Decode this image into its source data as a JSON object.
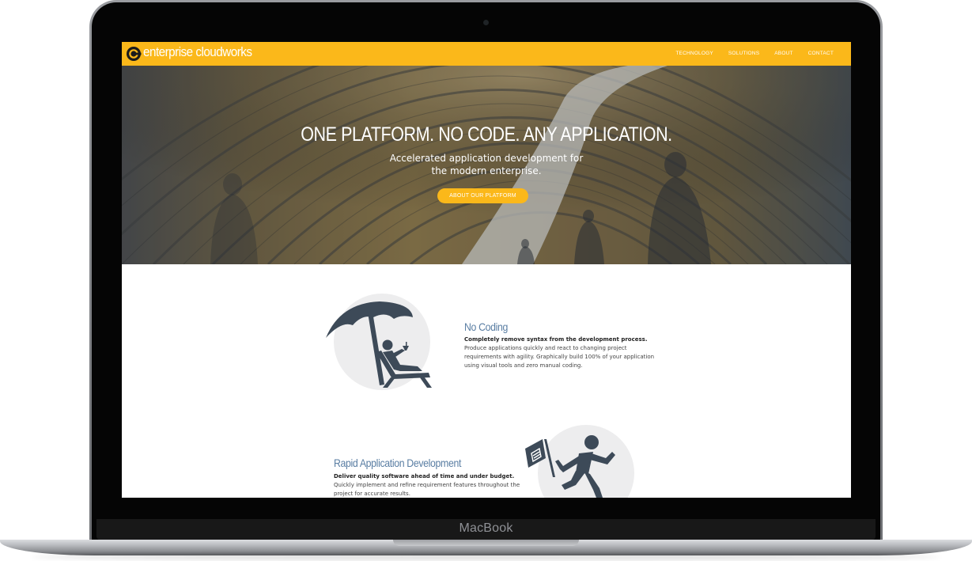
{
  "device": {
    "label": "MacBook"
  },
  "site": {
    "logo_text": "enterprise cloudworks",
    "brand_color": "#fbb81a",
    "nav": [
      {
        "label": "TECHNOLOGY"
      },
      {
        "label": "SOLUTIONS"
      },
      {
        "label": "ABOUT"
      },
      {
        "label": "CONTACT"
      }
    ]
  },
  "hero": {
    "title": "ONE PLATFORM. NO CODE. ANY APPLICATION.",
    "subtitle_line1": "Accelerated application development for",
    "subtitle_line2": "the modern enterprise.",
    "cta_label": "ABOUT OUR PLATFORM"
  },
  "features": [
    {
      "title": "No Coding",
      "lead": "Completely remove syntax from the development process.",
      "body": [
        "Produce applications quickly and react to changing project",
        "requirements with agility. Graphically build 100% of your application",
        "using visual tools and zero manual coding."
      ],
      "icon": "beach-chair-umbrella-icon"
    },
    {
      "title": "Rapid Application Development",
      "lead": "Deliver quality software ahead of time and under budget.",
      "body": [
        "Quickly implement and refine requirement features throughout the",
        "project for accurate results."
      ],
      "icon": "running-man-flag-icon"
    }
  ],
  "colors": {
    "feature_title": "#5a7ea3",
    "icon": "#3d4a58",
    "icon_circle": "#ededee"
  }
}
